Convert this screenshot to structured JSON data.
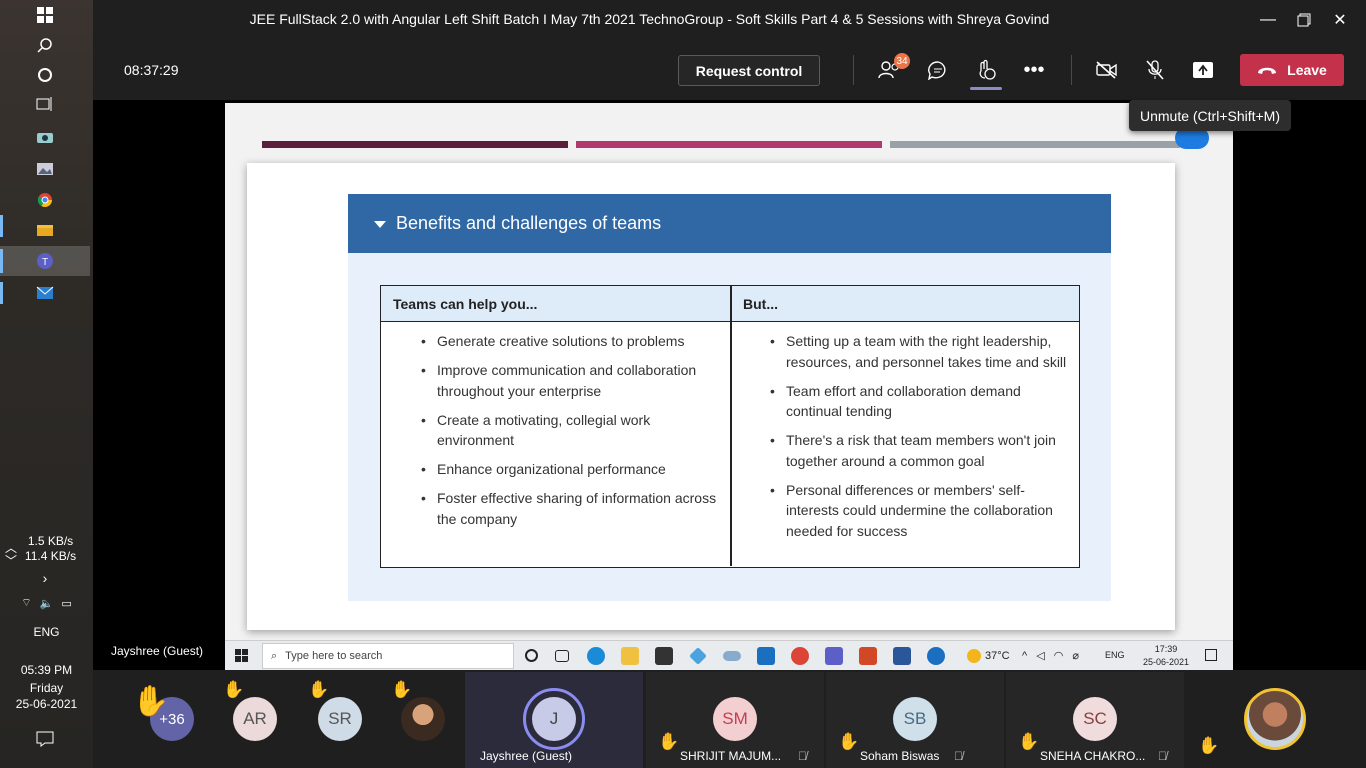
{
  "window": {
    "title": "JEE FullStack 2.0 with Angular Left Shift Batch I May 7th 2021 TechnoGroup - Soft Skills Part 4 & 5 Sessions with Shreya Govind"
  },
  "meeting_bar": {
    "timer": "08:37:29",
    "request_control_label": "Request control",
    "participants_count": "34",
    "leave_label": "Leave",
    "tooltip": "Unmute (Ctrl+Shift+M)"
  },
  "slide": {
    "panel_title": "Benefits and challenges of teams",
    "table": {
      "headers": [
        "Teams can help you...",
        "But..."
      ],
      "left_items": [
        "Generate creative solutions to problems",
        "Improve communication and collaboration throughout your enterprise",
        "Create a motivating, collegial work environment",
        "Enhance organizational performance",
        "Foster effective sharing of information across the company"
      ],
      "right_items": [
        "Setting up a team with the right leadership, resources, and personnel takes time and skill",
        "Team effort and collaboration demand continual tending",
        "There's a risk that team members won't join together around a common goal",
        "Personal differences or members' self-interests could undermine the collaboration needed for success"
      ]
    },
    "accent_colors": [
      "#5a1f3a",
      "#b03a6e",
      "#9aa0a8"
    ]
  },
  "presenter_name": "Jayshree (Guest)",
  "inner_taskbar": {
    "search_placeholder": "Type here to search",
    "temperature": "37°C",
    "lang": "ENG",
    "time": "17:39",
    "date": "25-06-2021"
  },
  "system_tray": {
    "upload_speed": "1.5 KB/s",
    "download_speed": "11.4 KB/s",
    "lang": "ENG",
    "time": "05:39 PM",
    "day": "Friday",
    "date": "25-06-2021"
  },
  "gallery": {
    "overflow_count": "+36",
    "participants": [
      {
        "initials": "AR",
        "color": "#ecd9d9",
        "text_color": "#555"
      },
      {
        "initials": "SR",
        "color": "#cfdbe6",
        "text_color": "#555"
      },
      {
        "initials": "J",
        "name": "Jayshree (Guest)",
        "color": "#c7cbe8",
        "text_color": "#444"
      },
      {
        "initials": "SM",
        "name": "SHRIJIT MAJUM...",
        "color": "#f4cfd2",
        "text_color": "#c04050"
      },
      {
        "initials": "SB",
        "name": "Soham Biswas",
        "color": "#cfe0ea",
        "text_color": "#4a6a80"
      },
      {
        "initials": "SC",
        "name": "SNEHA CHAKRO...",
        "color": "#f0dcdc",
        "text_color": "#884040"
      }
    ]
  },
  "colors": {
    "leave_red": "#c4314b",
    "panel_blue": "#2f68a5",
    "teams_dark": "#1f1f1f"
  }
}
